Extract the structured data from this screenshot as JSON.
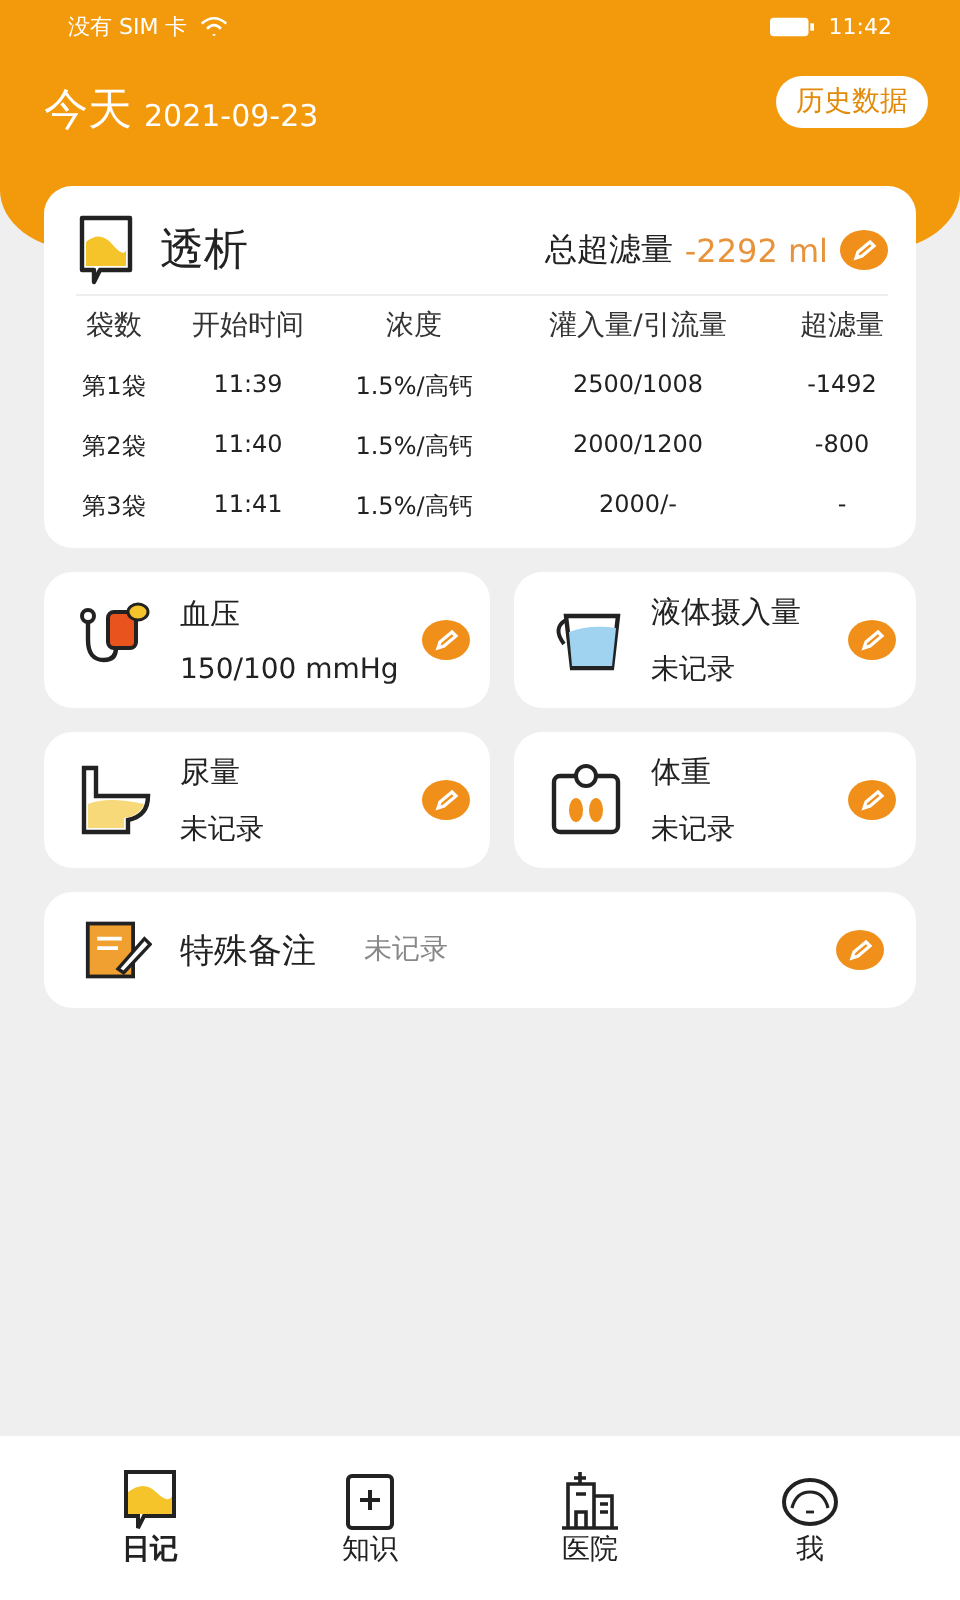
{
  "status_bar": {
    "carrier": "没有 SIM 卡",
    "time": "11:42"
  },
  "header": {
    "title": "今天",
    "date": "2021-09-23",
    "history_button": "历史数据"
  },
  "dialysis": {
    "title": "透析",
    "total_label": "总超滤量",
    "total_value": "-2292 ml",
    "columns": [
      "袋数",
      "开始时间",
      "浓度",
      "灌入量/引流量",
      "超滤量"
    ],
    "rows": [
      [
        "第1袋",
        "11:39",
        "1.5%/高钙",
        "2500/1008",
        "-1492"
      ],
      [
        "第2袋",
        "11:40",
        "1.5%/高钙",
        "2000/1200",
        "-800"
      ],
      [
        "第3袋",
        "11:41",
        "1.5%/高钙",
        "2000/-",
        "-"
      ]
    ]
  },
  "records": [
    {
      "kind": "blood-pressure",
      "label": "血压",
      "value": "150/100 mmHg"
    },
    {
      "kind": "fluid",
      "label": "液体摄入量",
      "value": "未记录"
    },
    {
      "kind": "urine",
      "label": "尿量",
      "value": "未记录"
    },
    {
      "kind": "weight",
      "label": "体重",
      "value": "未记录"
    }
  ],
  "note": {
    "label": "特殊备注",
    "value": "未记录"
  },
  "tabs": [
    {
      "label": "日记",
      "selected": true
    },
    {
      "label": "知识",
      "selected": false
    },
    {
      "label": "医院",
      "selected": false
    },
    {
      "label": "我",
      "selected": false
    }
  ]
}
